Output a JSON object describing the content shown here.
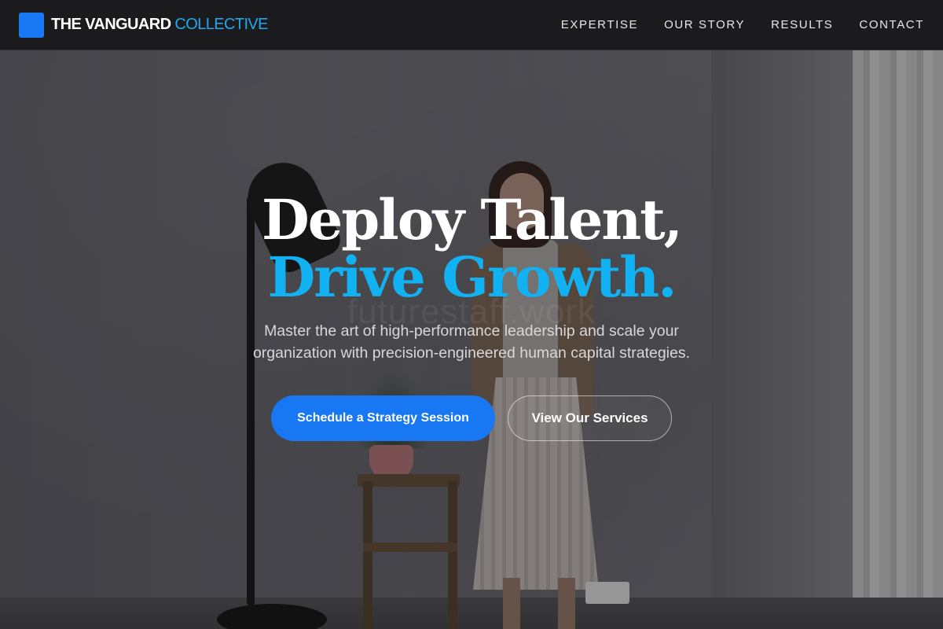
{
  "brand": {
    "name": "THE VANGUARD",
    "name_accent": "COLLECTIVE"
  },
  "nav": {
    "items": [
      {
        "label": "EXPERTISE"
      },
      {
        "label": "OUR STORY"
      },
      {
        "label": "RESULTS"
      },
      {
        "label": "CONTACT"
      }
    ]
  },
  "hero": {
    "headline_line1": "Deploy Talent,",
    "headline_line2": "Drive Growth.",
    "watermark": "futurestaff.work",
    "subtitle": "Master the art of high-performance leadership and scale your organization with precision-engineered human capital strategies.",
    "primary_cta": "Schedule a Strategy Session",
    "secondary_cta": "View Our Services"
  },
  "colors": {
    "brand_blue": "#1877f2",
    "accent_cyan": "#12b1f2",
    "header_bg": "#1b1b1d"
  }
}
